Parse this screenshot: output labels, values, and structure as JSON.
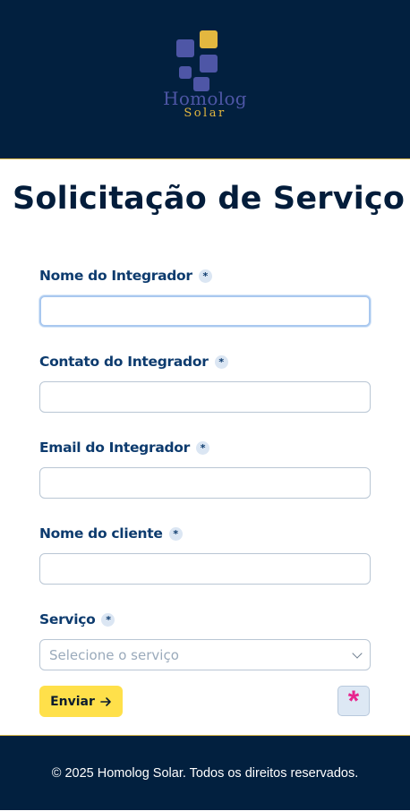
{
  "header": {
    "logo": {
      "name": "Homolog",
      "sub": "Solar",
      "colors": {
        "accent": "#e3b73f",
        "primary": "#4e56a6"
      }
    }
  },
  "main": {
    "title": "Solicitação de Serviço",
    "fields": [
      {
        "label": "Nome do Integrador",
        "required_mark": "*",
        "value": ""
      },
      {
        "label": "Contato do Integrador",
        "required_mark": "*",
        "value": ""
      },
      {
        "label": "Email do Integrador",
        "required_mark": "*",
        "value": ""
      },
      {
        "label": "Nome do cliente",
        "required_mark": "*",
        "value": ""
      }
    ],
    "service": {
      "label": "Serviço",
      "required_mark": "*",
      "placeholder": "Selecione o serviço"
    },
    "submit_label": "Enviar",
    "submit_icon": "arrow-right-icon",
    "star_button_icon": "asterisk-icon",
    "star_glyph": "*"
  },
  "footer": {
    "text": "© 2025 Homolog Solar. Todos os direitos reservados."
  },
  "colors": {
    "header_bg": "#02203f",
    "title": "#031d3b",
    "label": "#0d3b6e",
    "button": "#ffe04a",
    "star": "#e8248e"
  }
}
